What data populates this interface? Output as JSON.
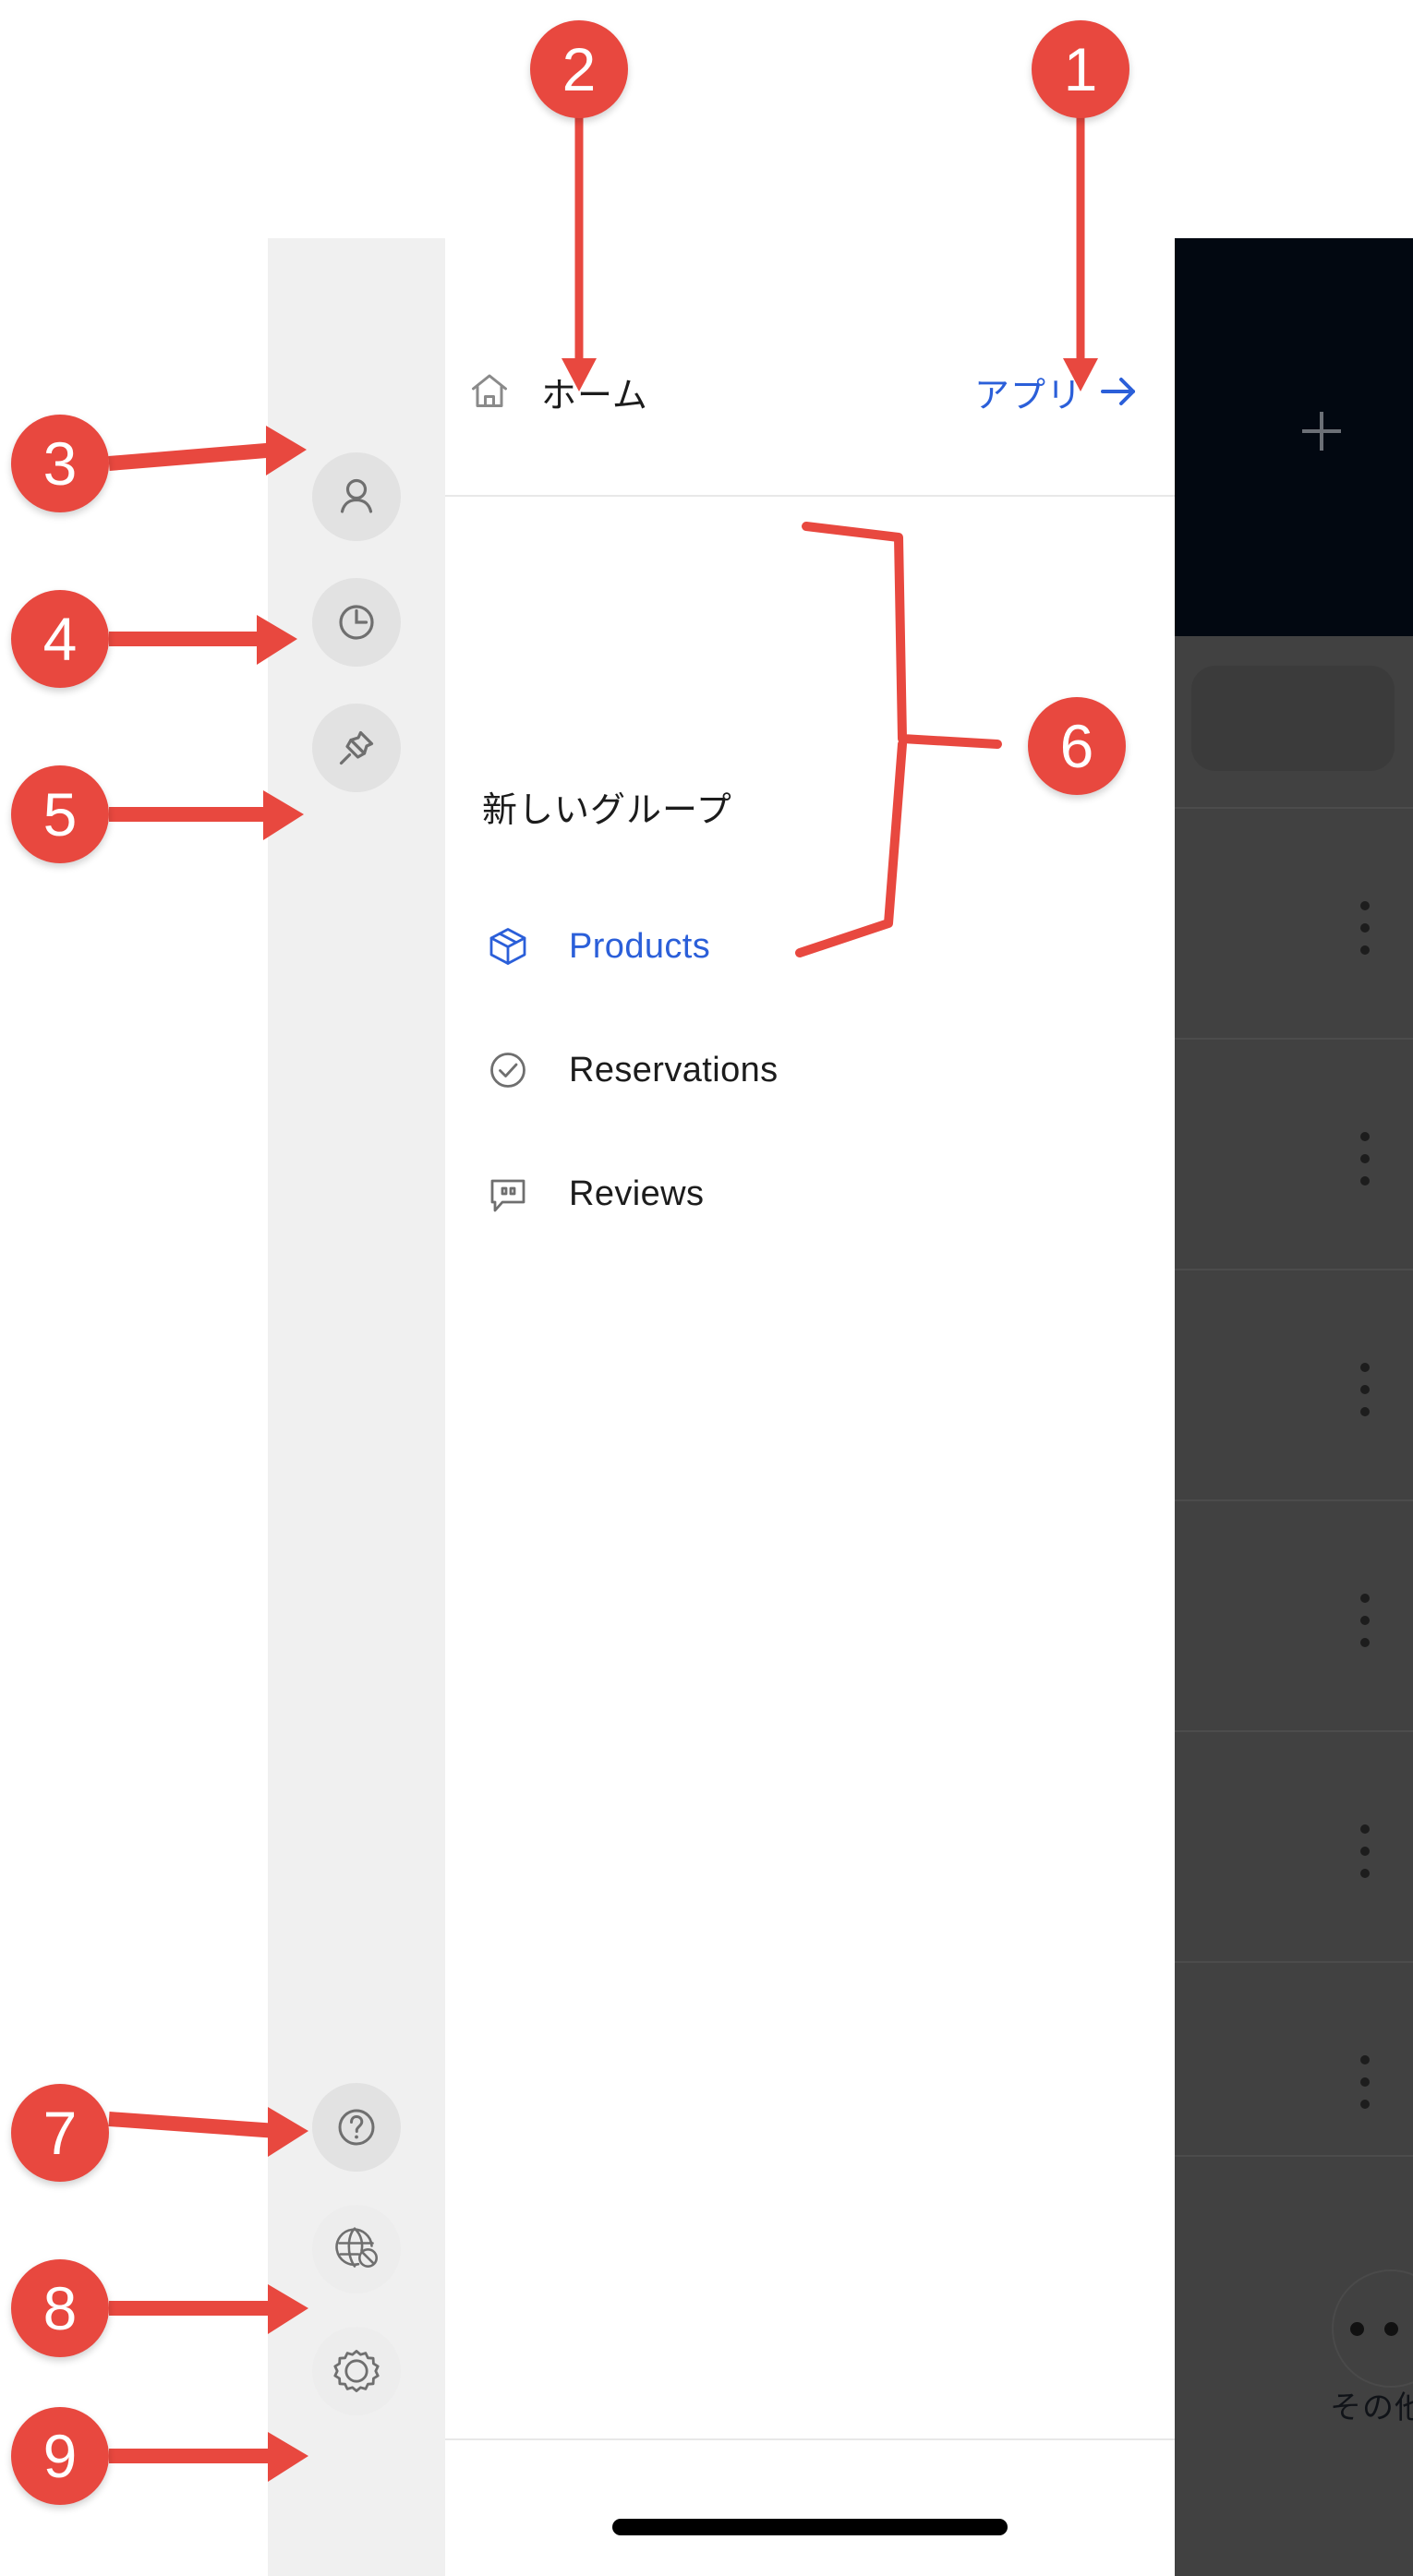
{
  "app": {
    "dark_panel": {
      "add_icon": "plus-icon",
      "partial_circle_icon": "circle-outline-icon"
    },
    "dimmed_list": {
      "kebab_icon": "kebab-menu-icon",
      "rows": 6
    },
    "more_button": {
      "icon": "ellipsis-horizontal-icon",
      "label": "その他"
    }
  },
  "icon_rail": {
    "top_items": [
      {
        "name": "account-button",
        "icon": "person-icon"
      },
      {
        "name": "history-button",
        "icon": "clock-icon"
      },
      {
        "name": "pinned-button",
        "icon": "pin-icon"
      }
    ],
    "bottom_items": [
      {
        "name": "help-button",
        "icon": "question-mark-icon"
      },
      {
        "name": "offline-button",
        "icon": "globe-slash-icon"
      },
      {
        "name": "settings-button",
        "icon": "gear-icon"
      }
    ]
  },
  "drawer": {
    "header": {
      "home_icon": "home-icon",
      "home_label": "ホーム",
      "apps_label": "アプリ",
      "apps_arrow_icon": "arrow-right-icon"
    },
    "group_title": "新しいグループ",
    "menu_items": [
      {
        "label": "Products",
        "icon": "package-box-icon",
        "active": true
      },
      {
        "label": "Reservations",
        "icon": "check-circle-icon",
        "active": false
      },
      {
        "label": "Reviews",
        "icon": "review-bubble-icon",
        "active": false
      }
    ]
  },
  "annotations": {
    "accent_color": "#e8483f",
    "badges": [
      {
        "label": "1",
        "target": "apps-link"
      },
      {
        "label": "2",
        "target": "home-label"
      },
      {
        "label": "3",
        "target": "account-button"
      },
      {
        "label": "4",
        "target": "history-button"
      },
      {
        "label": "5",
        "target": "pinned-button"
      },
      {
        "label": "6",
        "target": "menu-items-group"
      },
      {
        "label": "7",
        "target": "help-button"
      },
      {
        "label": "8",
        "target": "offline-button"
      },
      {
        "label": "9",
        "target": "settings-button"
      }
    ]
  },
  "colors": {
    "accent_blue": "#2b5fd9",
    "rail_bg": "#f0f0f0",
    "drawer_bg": "#ffffff",
    "dark_header": "#020811",
    "dim_overlay": "#414141",
    "annotation_red": "#e8483f"
  }
}
